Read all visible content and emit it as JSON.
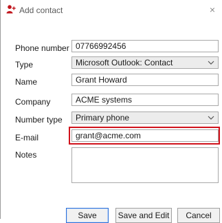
{
  "window": {
    "title": "Add contact",
    "close_glyph": "×",
    "icon": "add-contact-icon",
    "accent": "#c0141b"
  },
  "form": {
    "phone": {
      "label": "Phone number",
      "value": "07766992456"
    },
    "type": {
      "label": "Type",
      "value": "Microsoft Outlook: Contact"
    },
    "name": {
      "label": "Name",
      "value": "Grant Howard"
    },
    "company": {
      "label": "Company",
      "value": "ACME systems"
    },
    "number_type": {
      "label": "Number type",
      "value": "Primary phone"
    },
    "email": {
      "label": "E-mail",
      "value": "grant@acme.com",
      "highlight_color": "#d0121b"
    },
    "notes": {
      "label": "Notes",
      "value": ""
    }
  },
  "buttons": {
    "save": "Save",
    "save_and_edit": "Save and Edit",
    "cancel": "Cancel"
  }
}
